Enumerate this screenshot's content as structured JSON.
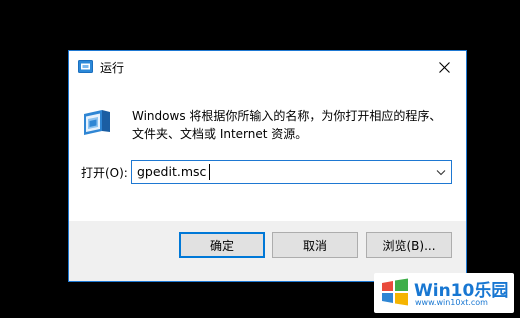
{
  "window": {
    "title": "运行",
    "icon": "run-icon"
  },
  "description": "Windows 将根据你所输入的名称，为你打开相应的程序、\n文件夹、文档或 Internet 资源。",
  "open_field": {
    "label": "打开(O):",
    "value": "gpedit.msc"
  },
  "buttons": {
    "ok": "确定",
    "cancel": "取消",
    "browse": "浏览(B)..."
  },
  "watermark": {
    "title": "Win10乐园",
    "url": "www.win10xt.com"
  },
  "colors": {
    "accent": "#1e78d2",
    "footer": "#f0f0f0"
  }
}
